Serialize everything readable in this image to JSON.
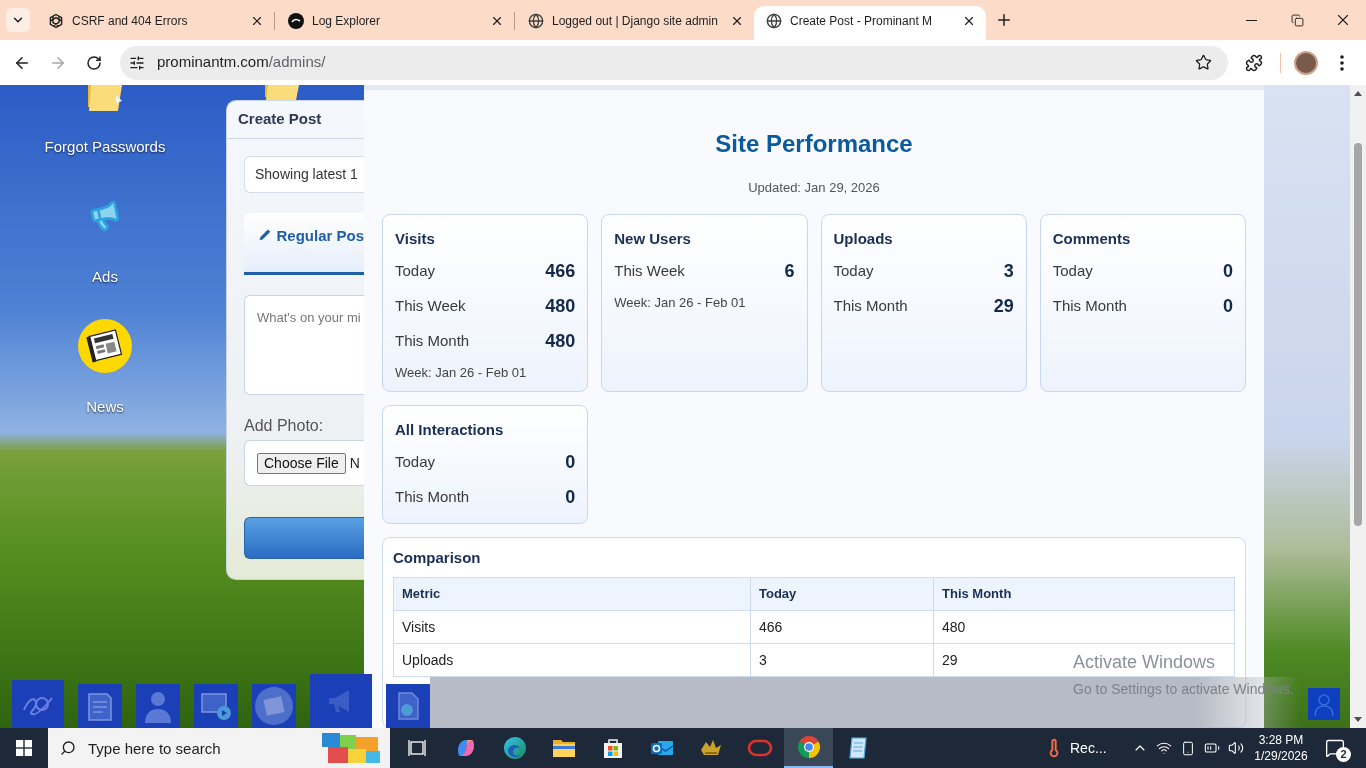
{
  "browser": {
    "tabs": [
      {
        "title": "CSRF and 404 Errors",
        "kind": "knot",
        "selected": false
      },
      {
        "title": "Log Explorer",
        "kind": "dark-circle",
        "selected": false
      },
      {
        "title": "Logged out | Django site admin",
        "kind": "globe",
        "selected": false
      },
      {
        "title": "Create Post - Prominant M",
        "kind": "globe",
        "selected": true
      }
    ],
    "forward_disabled": true,
    "address": {
      "host": "prominantm.com",
      "path": "/admins/"
    }
  },
  "desktop_icons": [
    {
      "kind": "folder",
      "label": "Forgot Passwords"
    },
    {
      "kind": "megaphone",
      "label": "Ads"
    },
    {
      "kind": "news",
      "label": "News"
    }
  ],
  "create_post": {
    "title": "Create Post",
    "notice": "Showing latest 1",
    "tabs": [
      {
        "label": "Regular Pos",
        "selected": true
      }
    ],
    "message": {
      "placeholder": "What's on your mi"
    },
    "photo_label": "Add Photo:",
    "file": {
      "button": "Choose File",
      "status": "N"
    }
  },
  "site_performance": {
    "title": "Site Performance",
    "updated": "Updated: Jan 29, 2026",
    "cards": [
      {
        "title": "Visits",
        "rows": [
          {
            "label": "Today",
            "value": "466"
          },
          {
            "label": "This Week",
            "value": "480"
          },
          {
            "label": "This Month",
            "value": "480"
          }
        ],
        "note": "Week: Jan 26 - Feb 01"
      },
      {
        "title": "New Users",
        "rows": [
          {
            "label": "This Week",
            "value": "6"
          }
        ],
        "note": "Week: Jan 26 - Feb 01"
      },
      {
        "title": "Uploads",
        "rows": [
          {
            "label": "Today",
            "value": "3"
          },
          {
            "label": "This Month",
            "value": "29"
          }
        ]
      },
      {
        "title": "Comments",
        "rows": [
          {
            "label": "Today",
            "value": "0"
          },
          {
            "label": "This Month",
            "value": "0"
          }
        ]
      },
      {
        "title": "All Interactions",
        "rows": [
          {
            "label": "Today",
            "value": "0"
          },
          {
            "label": "This Month",
            "value": "0"
          }
        ]
      }
    ],
    "comparison": {
      "title": "Comparison",
      "columns": [
        "Metric",
        "Today",
        "This Month"
      ],
      "rows": [
        [
          "Visits",
          "466",
          "480"
        ],
        [
          "Uploads",
          "3",
          "29"
        ]
      ]
    }
  },
  "activation_notice": {
    "title": "Activate Windows",
    "hint": "Go to Settings to activate Windows."
  },
  "taskbar": {
    "search": {
      "placeholder": "Type here to search"
    },
    "apps": [
      {
        "kind": "task-view",
        "selected": false
      },
      {
        "kind": "swirl",
        "selected": false
      },
      {
        "kind": "wave",
        "selected": false
      },
      {
        "kind": "folder",
        "selected": false
      },
      {
        "kind": "bag",
        "selected": false
      },
      {
        "kind": "mail",
        "selected": false
      },
      {
        "kind": "game",
        "selected": false
      },
      {
        "kind": "ring",
        "selected": false
      },
      {
        "kind": "browser",
        "selected": true
      },
      {
        "kind": "notepad",
        "selected": false
      }
    ],
    "weather": "Rec...",
    "time": "3:28 PM",
    "date": "1/29/2026",
    "notifications": "2"
  }
}
